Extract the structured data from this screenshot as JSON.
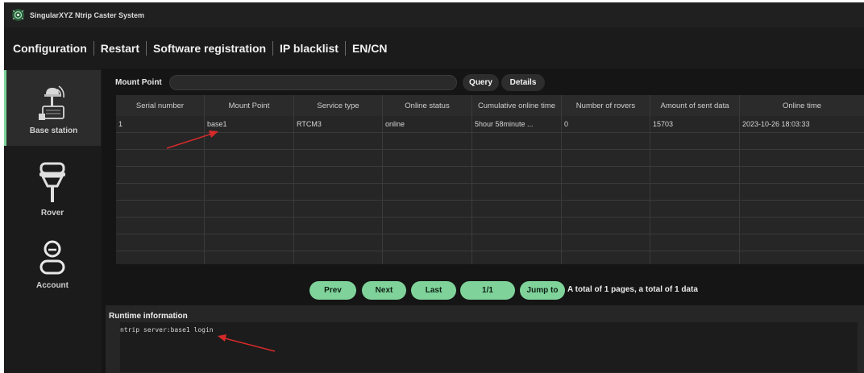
{
  "window": {
    "title": "SingularXYZ Ntrip Caster System",
    "logo_icon": "satellite-dish-icon"
  },
  "menu": {
    "items": [
      {
        "label": "Configuration"
      },
      {
        "label": "Restart"
      },
      {
        "label": "Software registration"
      },
      {
        "label": "IP blacklist"
      },
      {
        "label": "EN/CN"
      }
    ]
  },
  "sidebar": {
    "items": [
      {
        "label": "Base station",
        "icon": "base-station-icon",
        "active": true
      },
      {
        "label": "Rover",
        "icon": "rover-icon",
        "active": false
      },
      {
        "label": "Account",
        "icon": "account-icon",
        "active": false
      }
    ]
  },
  "search": {
    "label": "Mount Point",
    "value": "",
    "query_label": "Query",
    "details_label": "Details"
  },
  "table": {
    "columns": [
      "Serial number",
      "Mount Point",
      "Service type",
      "Online status",
      "Cumulative online time",
      "Number of rovers",
      "Amount of sent data",
      "Online time"
    ],
    "rows": [
      [
        "1",
        "base1",
        "RTCM3",
        "online",
        "5hour 58minute ...",
        "0",
        "15703",
        "2023-10-26 18:03:33"
      ]
    ],
    "empty_rows": 8
  },
  "pagination": {
    "prev_label": "Prev",
    "next_label": "Next",
    "last_label": "Last",
    "page_indicator": "1/1",
    "jump_label": "Jump to",
    "summary": "A total of 1 pages, a total of 1 data"
  },
  "runtime": {
    "title": "Runtime information",
    "log": "ntrip server:base1 login"
  },
  "colors": {
    "accent": "#7fd39a",
    "annotation": "#d42a2a",
    "background": "#1b1b1b"
  }
}
